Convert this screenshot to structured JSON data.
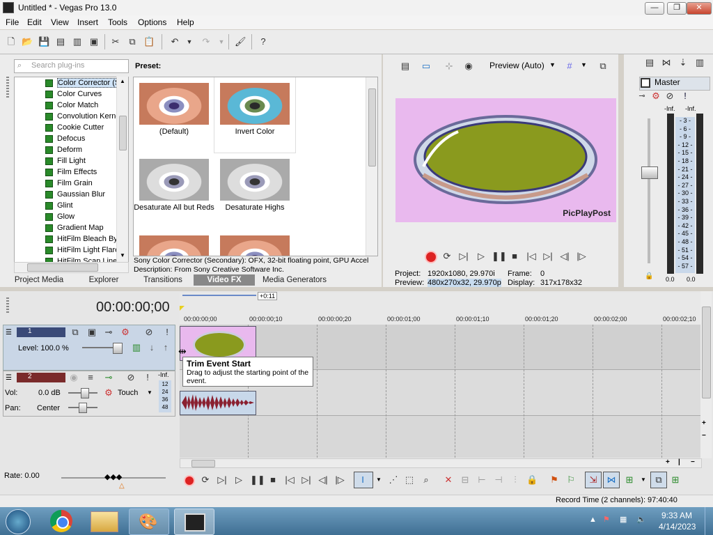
{
  "window": {
    "title": "Untitled * - Vegas Pro 13.0"
  },
  "menu": [
    "File",
    "Edit",
    "View",
    "Insert",
    "Tools",
    "Options",
    "Help"
  ],
  "plugins": {
    "search_placeholder": "Search plug-ins",
    "items": [
      "Color Corrector (S",
      "Color Curves",
      "Color Match",
      "Convolution Kerne",
      "Cookie Cutter",
      "Defocus",
      "Deform",
      "Fill Light",
      "Film Effects",
      "Film Grain",
      "Gaussian Blur",
      "Glint",
      "Glow",
      "Gradient Map",
      "HitFilm Bleach Byp",
      "HitFilm Light Flares",
      "HitFilm Scan Lines"
    ]
  },
  "presets": {
    "label": "Preset:",
    "items": [
      "(Default)",
      "Invert Color",
      "Desaturate All but Reds",
      "Desaturate Highs"
    ],
    "status_line1": "Sony Color Corrector (Secondary): OFX, 32-bit floating point, GPU Accel",
    "status_line2": "Description: From Sony Creative Software Inc."
  },
  "tabs": [
    "Project Media",
    "Explorer",
    "Transitions",
    "Video FX",
    "Media Generators"
  ],
  "preview": {
    "mode": "Preview (Auto)",
    "watermark": "PicPlayPost",
    "project_label": "Project:",
    "project_value": "1920x1080, 29.970i",
    "preview_label": "Preview:",
    "preview_value": "480x270x32, 29.970p",
    "frame_label": "Frame:",
    "frame_value": "0",
    "display_label": "Display:",
    "display_value": "317x178x32"
  },
  "master": {
    "label": "Master",
    "inf_left": "-Inf.",
    "inf_right": "-Inf.",
    "scale": [
      "3",
      "6",
      "9",
      "12",
      "15",
      "18",
      "21",
      "24",
      "27",
      "30",
      "33",
      "36",
      "39",
      "42",
      "45",
      "48",
      "51",
      "54",
      "57"
    ],
    "bottom_left": "0.0",
    "bottom_right": "0.0"
  },
  "timeline": {
    "timecode": "00:00:00;00",
    "marker": "+0:11",
    "ruler": [
      "00:00:00;00",
      "00:00:00;10",
      "00:00:00;20",
      "00:00:01;00",
      "00:00:01;10",
      "00:00:01;20",
      "00:00:02;00",
      "00:00:02;10"
    ],
    "track1": {
      "number": "1",
      "level": "Level: 100.0 %"
    },
    "track2": {
      "number": "2",
      "vol_label": "Vol:",
      "vol_value": "0.0 dB",
      "pan_label": "Pan:",
      "pan_value": "Center",
      "automation": "Touch",
      "inf": "-Inf.",
      "meter": [
        "12",
        "24",
        "36",
        "48"
      ]
    },
    "rate": "Rate: 0.00",
    "record_time": "Record Time (2 channels): 97:40:40"
  },
  "tooltip": {
    "title": "Trim Event Start",
    "body": "Drag to adjust the starting point of the event."
  },
  "taskbar": {
    "time": "9:33 AM",
    "date": "4/14/2023"
  }
}
